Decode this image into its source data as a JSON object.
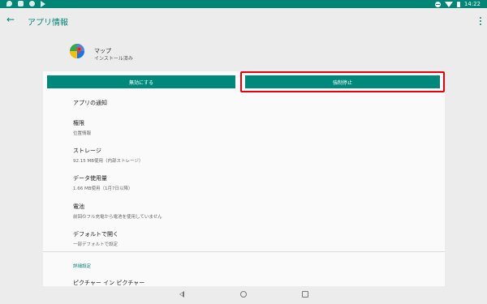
{
  "status_bar": {
    "time": "14:22",
    "left_icons": [
      "shield-icon",
      "notification-icon",
      "location-icon",
      "play-store-icon"
    ],
    "right_icons": [
      "do-not-disturb-icon",
      "wifi-icon",
      "battery-icon"
    ]
  },
  "app_bar": {
    "title": "アプリ情報",
    "back_icon": "arrow-back-icon",
    "overflow_icon": "more-vert-icon"
  },
  "app": {
    "name": "マップ",
    "status": "インストール済み",
    "icon": "google-maps-icon"
  },
  "buttons": {
    "disable": "無効にする",
    "force_stop": "強制停止"
  },
  "settings": [
    {
      "title": "アプリの通知",
      "subtitle": ""
    },
    {
      "title": "権限",
      "subtitle": "位置情報"
    },
    {
      "title": "ストレージ",
      "subtitle": "92.15 MB使用（内部ストレージ）"
    },
    {
      "title": "データ使用量",
      "subtitle": "1.66 MB使用（1月7日以降）"
    },
    {
      "title": "電池",
      "subtitle": "前回のフル充電から電池を使用していません"
    },
    {
      "title": "デフォルトで開く",
      "subtitle": "一部デフォルトで設定"
    }
  ],
  "advanced": {
    "header": "詳細設定",
    "first_item": "ピクチャー イン ピクチャー"
  },
  "colors": {
    "accent": "#008577",
    "button": "#00897b",
    "highlight": "#e8000b"
  }
}
